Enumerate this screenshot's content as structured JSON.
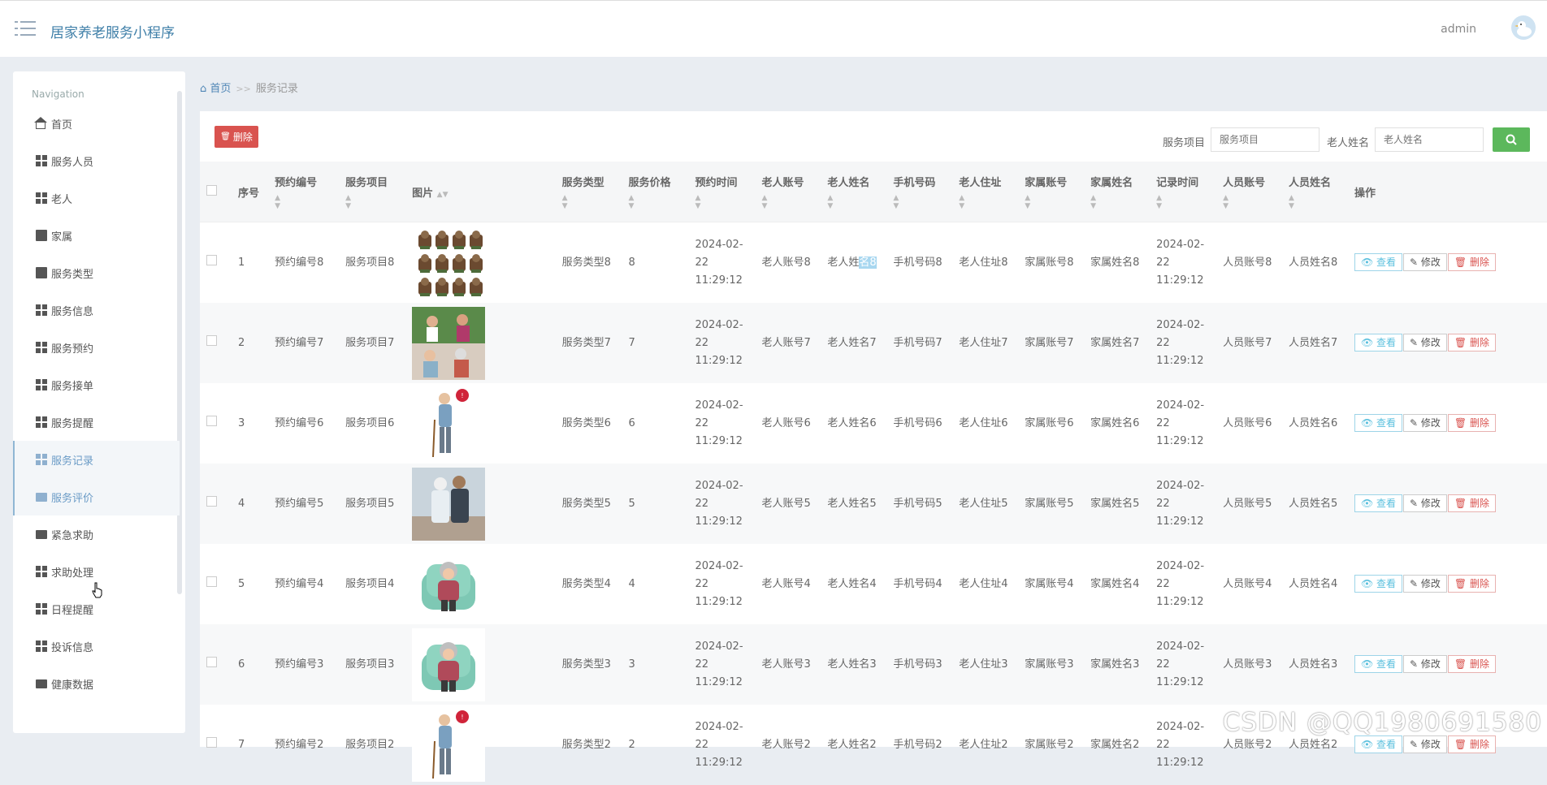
{
  "header": {
    "app_title": "居家养老服务小程序",
    "user": "admin"
  },
  "sidebar": {
    "heading": "Navigation",
    "items": [
      {
        "label": "首页",
        "icon": "home-icon"
      },
      {
        "label": "服务人员",
        "icon": "grid-icon"
      },
      {
        "label": "老人",
        "icon": "grid-icon"
      },
      {
        "label": "家属",
        "icon": "trash-icon"
      },
      {
        "label": "服务类型",
        "icon": "ticket-icon"
      },
      {
        "label": "服务信息",
        "icon": "grid-icon"
      },
      {
        "label": "服务预约",
        "icon": "grid-icon"
      },
      {
        "label": "服务接单",
        "icon": "grid-icon"
      },
      {
        "label": "服务提醒",
        "icon": "grid-icon"
      },
      {
        "label": "服务记录",
        "icon": "grid-icon",
        "active": true
      },
      {
        "label": "服务评价",
        "icon": "monitor-icon",
        "active": true
      },
      {
        "label": "紧急求助",
        "icon": "monitor-icon"
      },
      {
        "label": "求助处理",
        "icon": "grid-icon"
      },
      {
        "label": "日程提醒",
        "icon": "grid-icon"
      },
      {
        "label": "投诉信息",
        "icon": "grid-icon"
      },
      {
        "label": "健康数据",
        "icon": "monitor-icon"
      }
    ]
  },
  "breadcrumb": {
    "home": "首页",
    "separator": ">>",
    "current": "服务记录"
  },
  "toolbar": {
    "delete_label": "删除",
    "search_service_label": "服务项目",
    "search_service_placeholder": "服务项目",
    "search_elder_label": "老人姓名",
    "search_elder_placeholder": "老人姓名"
  },
  "table": {
    "columns": [
      "序号",
      "预约编号",
      "服务项目",
      "图片",
      "服务类型",
      "服务价格",
      "预约时间",
      "老人账号",
      "老人姓名",
      "手机号码",
      "老人住址",
      "家属账号",
      "家属姓名",
      "记录时间",
      "人员账号",
      "人员姓名",
      "操作"
    ],
    "actions": {
      "view": "查看",
      "edit": "修改",
      "delete": "删除"
    },
    "rows": [
      {
        "no": "1",
        "booking": "预约编号8",
        "service": "服务项目8",
        "image": "figurines",
        "type": "服务类型8",
        "price": "8",
        "time": "2024-02-22 11:29:12",
        "elder_acct": "老人账号8",
        "elder_name_a": "老人姓",
        "elder_name_b": "名8",
        "phone": "手机号码8",
        "address": "老人住址8",
        "family_acct": "家属账号8",
        "family_name": "家属姓名8",
        "record_time": "2024-02-22 11:29:12",
        "staff_acct": "人员账号8",
        "staff_name": "人员姓名8"
      },
      {
        "no": "2",
        "booking": "预约编号7",
        "service": "服务项目7",
        "image": "caregivers",
        "type": "服务类型7",
        "price": "7",
        "time": "2024-02-22 11:29:12",
        "elder_acct": "老人账号7",
        "elder_name": "老人姓名7",
        "phone": "手机号码7",
        "address": "老人住址7",
        "family_acct": "家属账号7",
        "family_name": "家属姓名7",
        "record_time": "2024-02-22 11:29:12",
        "staff_acct": "人员账号7",
        "staff_name": "人员姓名7"
      },
      {
        "no": "3",
        "booking": "预约编号6",
        "service": "服务项目6",
        "image": "elder-cane",
        "type": "服务类型6",
        "price": "6",
        "time": "2024-02-22 11:29:12",
        "elder_acct": "老人账号6",
        "elder_name": "老人姓名6",
        "phone": "手机号码6",
        "address": "老人住址6",
        "family_acct": "家属账号6",
        "family_name": "家属姓名6",
        "record_time": "2024-02-22 11:29:12",
        "staff_acct": "人员账号6",
        "staff_name": "人员姓名6"
      },
      {
        "no": "4",
        "booking": "预约编号5",
        "service": "服务项目5",
        "image": "caregiver-help",
        "type": "服务类型5",
        "price": "5",
        "time": "2024-02-22 11:29:12",
        "elder_acct": "老人账号5",
        "elder_name": "老人姓名5",
        "phone": "手机号码5",
        "address": "老人住址5",
        "family_acct": "家属账号5",
        "family_name": "家属姓名5",
        "record_time": "2024-02-22 11:29:12",
        "staff_acct": "人员账号5",
        "staff_name": "人员姓名5"
      },
      {
        "no": "5",
        "booking": "预约编号4",
        "service": "服务项目4",
        "image": "elder-armchair",
        "type": "服务类型4",
        "price": "4",
        "time": "2024-02-22 11:29:12",
        "elder_acct": "老人账号4",
        "elder_name": "老人姓名4",
        "phone": "手机号码4",
        "address": "老人住址4",
        "family_acct": "家属账号4",
        "family_name": "家属姓名4",
        "record_time": "2024-02-22 11:29:12",
        "staff_acct": "人员账号4",
        "staff_name": "人员姓名4"
      },
      {
        "no": "6",
        "booking": "预约编号3",
        "service": "服务项目3",
        "image": "elder-armchair",
        "type": "服务类型3",
        "price": "3",
        "time": "2024-02-22 11:29:12",
        "elder_acct": "老人账号3",
        "elder_name": "老人姓名3",
        "phone": "手机号码3",
        "address": "老人住址3",
        "family_acct": "家属账号3",
        "family_name": "家属姓名3",
        "record_time": "2024-02-22 11:29:12",
        "staff_acct": "人员账号3",
        "staff_name": "人员姓名3"
      },
      {
        "no": "7",
        "booking": "预约编号2",
        "service": "服务项目2",
        "image": "elder-cane",
        "type": "服务类型2",
        "price": "2",
        "time": "2024-02-22 11:29:12",
        "elder_acct": "老人账号2",
        "elder_name": "老人姓名2",
        "phone": "手机号码2",
        "address": "老人住址2",
        "family_acct": "家属账号2",
        "family_name": "家属姓名2",
        "record_time": "2024-02-22 11:29:12",
        "staff_acct": "人员账号2",
        "staff_name": "人员姓名2"
      }
    ]
  },
  "watermark": "CSDN @QQ1980691580",
  "colors": {
    "brand": "#3f7fa8",
    "danger": "#d9534f",
    "success": "#5cb85c",
    "info": "#5bc0de"
  }
}
